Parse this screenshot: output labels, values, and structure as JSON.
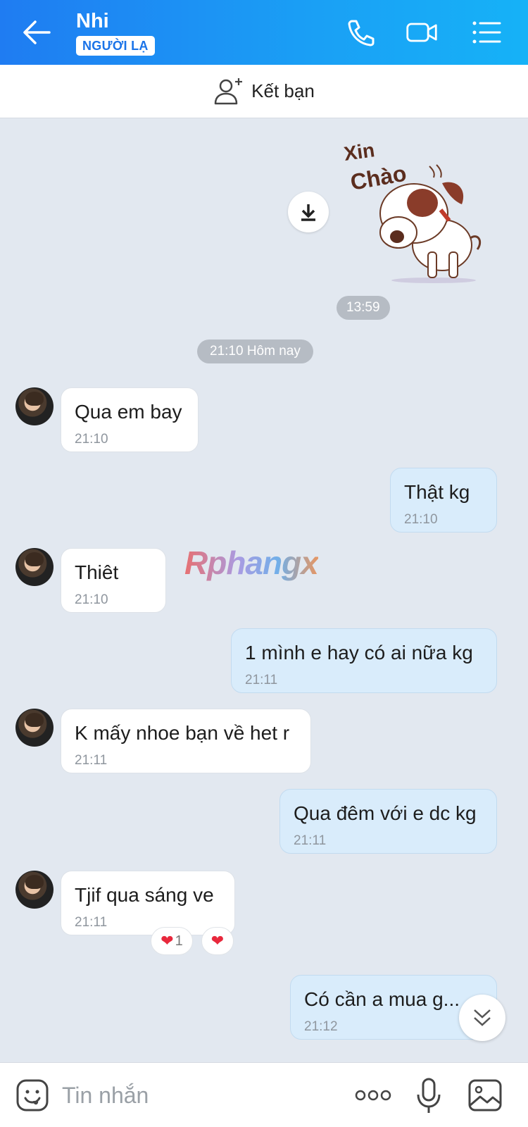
{
  "header": {
    "contact_name": "Nhi",
    "badge": "NGƯỜI LẠ"
  },
  "add_friend": {
    "label": "Kết bạn"
  },
  "sticker": {
    "caption": "Xin Chào",
    "time": "13:59"
  },
  "date_separator": "21:10 Hôm nay",
  "messages": [
    {
      "dir": "in",
      "text": "Qua em bay",
      "time": "21:10"
    },
    {
      "dir": "out",
      "text": "Thật kg",
      "time": "21:10"
    },
    {
      "dir": "in",
      "text": "Thiêt",
      "time": "21:10"
    },
    {
      "dir": "out",
      "text": "1 mình e hay có ai nữa kg",
      "time": "21:11"
    },
    {
      "dir": "in",
      "text": "K mấy nhoe bạn về het r",
      "time": "21:11"
    },
    {
      "dir": "out",
      "text": "Qua đêm với e dc kg",
      "time": "21:11"
    },
    {
      "dir": "in",
      "text": "Tjif qua sáng ve",
      "time": "21:11"
    },
    {
      "dir": "out",
      "text": "Có cần a mua g...",
      "time": "21:12"
    }
  ],
  "reactions": {
    "count": "1"
  },
  "watermark": "Rphangx",
  "input": {
    "placeholder": "Tin nhắn"
  },
  "colors": {
    "header_start": "#1f7cf2",
    "header_end": "#16b2f7",
    "bubble_out": "#d9ecfb",
    "bubble_in": "#ffffff",
    "heart": "#e8283c"
  }
}
